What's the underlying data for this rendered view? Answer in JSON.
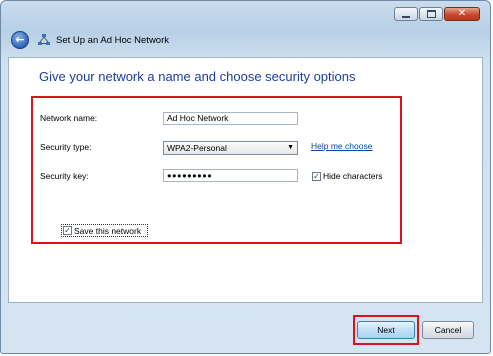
{
  "window": {
    "title": "Set Up an Ad Hoc Network",
    "controls": {
      "minimize": "minimize",
      "maximize": "maximize",
      "close": "✕"
    },
    "back_glyph": "←"
  },
  "main": {
    "heading": "Give your network a name and choose security options",
    "network_name": {
      "label": "Network name:",
      "value": "Ad Hoc Network"
    },
    "security_type": {
      "label": "Security type:",
      "value": "WPA2-Personal",
      "help_link": "Help me choose"
    },
    "security_key": {
      "label": "Security key:",
      "value": "●●●●●●●●●",
      "hide_characters": {
        "label": "Hide characters",
        "checked": true
      }
    },
    "save_network": {
      "label": "Save this network",
      "checked": true
    }
  },
  "footer": {
    "next_label": "Next",
    "cancel_label": "Cancel"
  },
  "colors": {
    "highlight": "#d8141c",
    "heading": "#1e3e9e",
    "link": "#0645ad"
  },
  "check_glyph": "✓"
}
